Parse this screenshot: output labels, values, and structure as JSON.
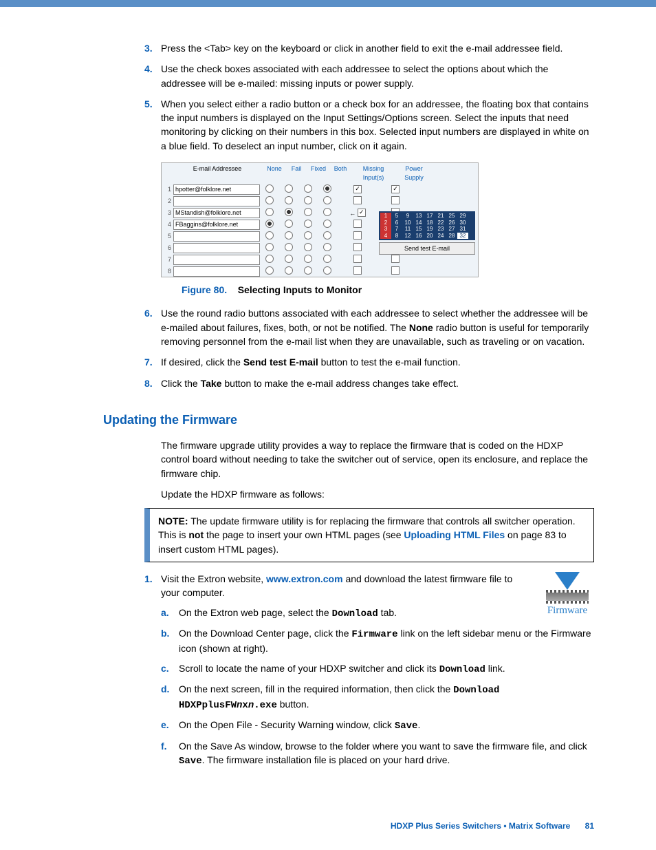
{
  "steps_top": [
    {
      "n": "3.",
      "text": "Press the <Tab> key on the keyboard or click in another field to exit the e-mail addressee field."
    },
    {
      "n": "4.",
      "text": "Use the check boxes associated with each addressee to select the options about which the addressee will be e-mailed: missing inputs or power supply."
    },
    {
      "n": "5.",
      "text": "When you select either a radio button or a check box for an addressee, the floating box that contains the input numbers is displayed on the Input Settings/Options screen. Select the inputs that need monitoring by clicking on their numbers in this box. Selected input numbers are displayed in white on a blue field. To deselect an input number, click on it again."
    }
  ],
  "figure": {
    "header_addr": "E-mail Addressee",
    "cols": [
      "None",
      "Fail",
      "Fixed",
      "Both"
    ],
    "col_inputs": "Missing Input(s)",
    "col_power": "Power Supply",
    "rows": [
      {
        "n": "1",
        "email": "hpotter@folklore.net",
        "sel": 3,
        "inputs": true,
        "power": true
      },
      {
        "n": "2",
        "email": "",
        "sel": null,
        "inputs": false,
        "power": false
      },
      {
        "n": "3",
        "email": "MStandish@folklore.net",
        "sel": 1,
        "inputs": true,
        "power": false,
        "arrow": true
      },
      {
        "n": "4",
        "email": "FBaggins@folklore.net",
        "sel": 0,
        "inputs": false,
        "power": true
      },
      {
        "n": "5",
        "email": "",
        "sel": null,
        "inputs": false,
        "power": false
      },
      {
        "n": "6",
        "email": "",
        "sel": null,
        "inputs": false,
        "power": false
      },
      {
        "n": "7",
        "email": "",
        "sel": null,
        "inputs": false,
        "power": false
      },
      {
        "n": "8",
        "email": "",
        "sel": null,
        "inputs": false,
        "power": false
      }
    ],
    "send_btn": "Send test E-mail",
    "caption_num": "Figure 80.",
    "caption_text": "Selecting Inputs to Monitor"
  },
  "steps_mid": [
    {
      "n": "6.",
      "parts": [
        {
          "t": "Use the round radio buttons associated with each addressee to select whether the addressee will be e-mailed about failures, fixes, both, or not be notified. The "
        },
        {
          "t": "None",
          "b": true
        },
        {
          "t": " radio button is useful for temporarily removing personnel from the e-mail list when they are unavailable, such as traveling or on vacation."
        }
      ]
    },
    {
      "n": "7.",
      "parts": [
        {
          "t": "If desired, click the "
        },
        {
          "t": "Send test E-mail",
          "b": true
        },
        {
          "t": " button to test the e-mail function."
        }
      ]
    },
    {
      "n": "8.",
      "parts": [
        {
          "t": "Click the "
        },
        {
          "t": "Take",
          "b": true
        },
        {
          "t": " button to make the e-mail address changes take effect."
        }
      ]
    }
  ],
  "section_heading": "Updating the Firmware",
  "firmware_intro": "The firmware upgrade utility provides a way to replace the firmware that is coded on the HDXP control board without needing to take the switcher out of service, open its enclosure, and replace the firmware chip.",
  "firmware_lead": "Update the HDXP firmware as follows:",
  "note": {
    "label": "NOTE:",
    "p1": "The update firmware utility is for replacing the firmware that controls all switcher operation. This is ",
    "not": "not",
    "p2": " the page to insert your own HTML pages (see ",
    "link": "Uploading HTML Files",
    "p3": " on page 83 to insert custom HTML pages)."
  },
  "fw_icon_label": "Firmware",
  "steps_fw": [
    {
      "n": "1.",
      "parts": [
        {
          "t": "Visit the Extron website, "
        },
        {
          "t": "www.extron.com",
          "link": true
        },
        {
          "t": " and download the latest firmware file to your computer."
        }
      ],
      "subs": [
        {
          "l": "a.",
          "parts": [
            {
              "t": "On the Extron web page, select the "
            },
            {
              "t": "Download",
              "mono": true
            },
            {
              "t": " tab."
            }
          ]
        },
        {
          "l": "b.",
          "parts": [
            {
              "t": "On the Download Center page, click the "
            },
            {
              "t": "Firmware",
              "mono": true
            },
            {
              "t": " link on the left sidebar menu or the Firmware icon (shown at right)."
            }
          ]
        },
        {
          "l": "c.",
          "parts": [
            {
              "t": "Scroll to locate the name of your HDXP switcher and click its "
            },
            {
              "t": "Download",
              "mono": true
            },
            {
              "t": " link."
            }
          ]
        },
        {
          "l": "d.",
          "parts": [
            {
              "t": "On the next screen, fill in the required information, then click the "
            },
            {
              "t": "Download HDXPplusFW",
              "mono": true
            },
            {
              "t": "n",
              "mono": true,
              "i": true
            },
            {
              "t": "x",
              "mono": true
            },
            {
              "t": "n",
              "mono": true,
              "i": true
            },
            {
              "t": ".exe",
              "mono": true
            },
            {
              "t": " button."
            }
          ]
        },
        {
          "l": "e.",
          "parts": [
            {
              "t": "On the Open File - Security Warning window, click "
            },
            {
              "t": "Save",
              "mono": true
            },
            {
              "t": "."
            }
          ]
        },
        {
          "l": "f.",
          "parts": [
            {
              "t": "On the Save As window, browse to the folder where you want to save the firmware file, and click "
            },
            {
              "t": "Save",
              "mono": true
            },
            {
              "t": ". The firmware installation file is placed on your hard drive."
            }
          ]
        }
      ]
    }
  ],
  "footer": {
    "title": "HDXP Plus Series Switchers • Matrix Software",
    "page": "81"
  }
}
